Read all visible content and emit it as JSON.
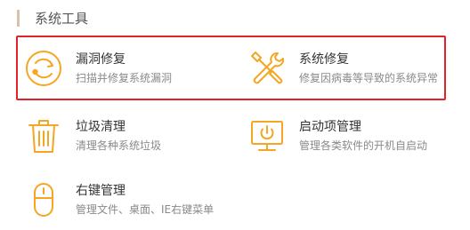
{
  "section": {
    "title": "系统工具"
  },
  "tools": [
    {
      "label": "漏洞修复",
      "desc": "扫描并修复系统漏洞",
      "icon": "circular-arrows-icon"
    },
    {
      "label": "系统修复",
      "desc": "修复因病毒等导致的系统异常",
      "icon": "wrench-screwdriver-icon"
    },
    {
      "label": "垃圾清理",
      "desc": "清理各种系统垃圾",
      "icon": "trash-icon"
    },
    {
      "label": "启动项管理",
      "desc": "管理各类软件的开机自启动",
      "icon": "monitor-power-icon"
    },
    {
      "label": "右键管理",
      "desc": "管理文件、桌面、IE右键菜单",
      "icon": "mouse-icon"
    }
  ],
  "colors": {
    "accent": "#f5a623",
    "highlight_border": "#e0232b",
    "section_bar": "#d6c4a8"
  }
}
